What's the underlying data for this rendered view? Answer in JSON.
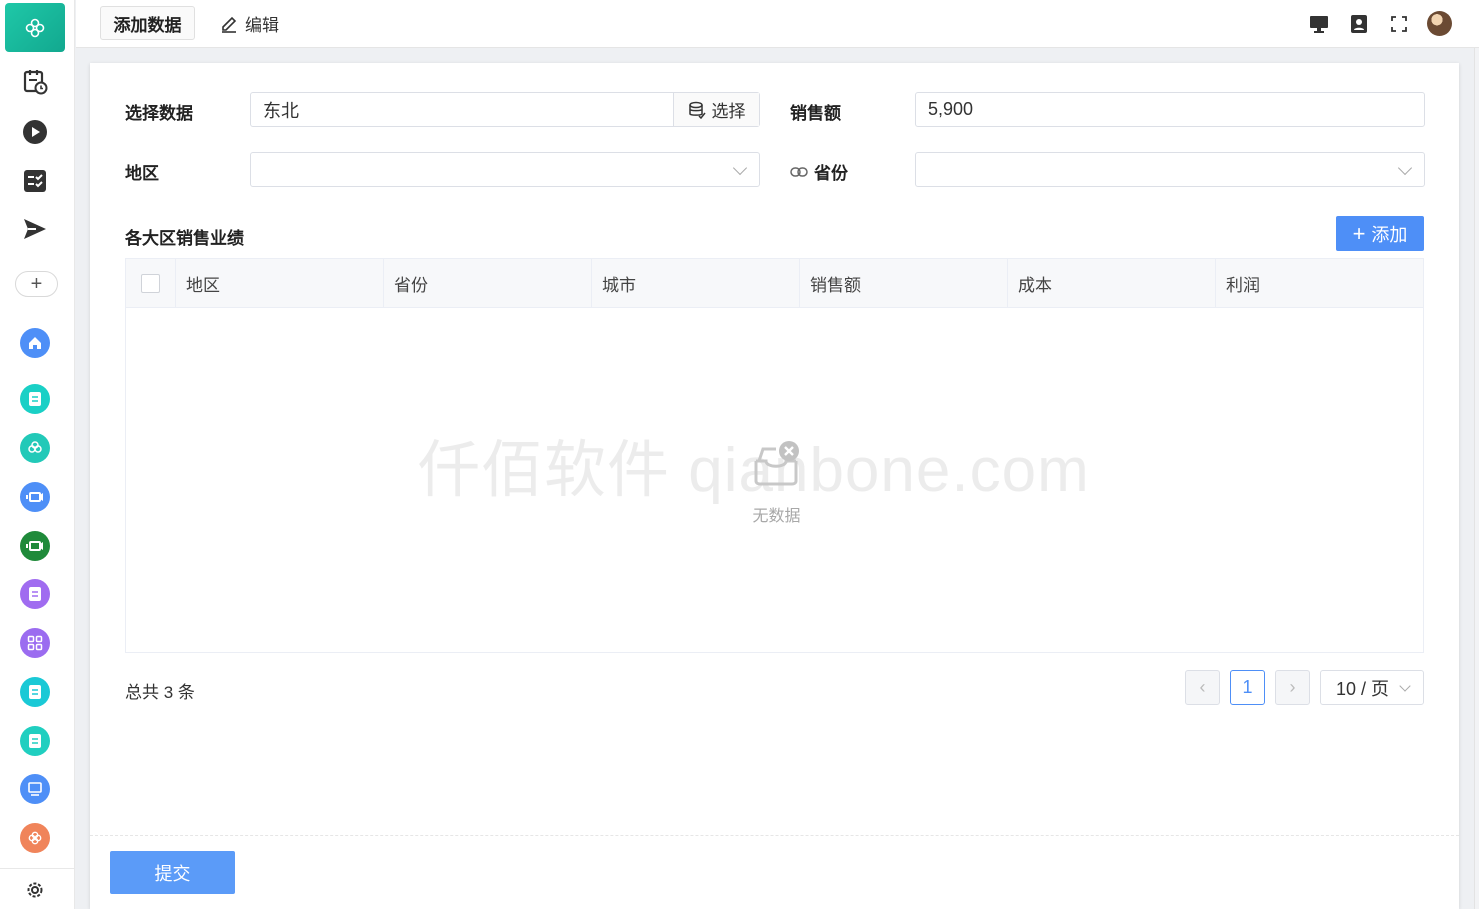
{
  "topbar": {
    "tab_active": "添加数据",
    "tab_edit": "编辑"
  },
  "sidebar": {
    "add_label": "+",
    "colors": {
      "home": "#4e8ff7",
      "doc_teal": "#1ad0c6",
      "flower_teal": "#22c9b8",
      "cam_blue": "#4e8ff7",
      "cam_green": "#1f8a3a",
      "doc_purple": "#a06cf0",
      "grid_purple": "#9b6cf0",
      "doc_teal2": "#1ac9d6",
      "doc_teal3": "#20cfc0",
      "screen_blue": "#4e8ff7",
      "flower_orange": "#f0845a"
    }
  },
  "form": {
    "select_data_label": "选择数据",
    "select_data_value": "东北",
    "select_button_label": "选择",
    "sales_label": "销售额",
    "sales_value": "5,900",
    "region_label": "地区",
    "region_value": "",
    "province_label": "省份",
    "province_value": ""
  },
  "table": {
    "title": "各大区销售业绩",
    "add_button": "添加",
    "columns": [
      "地区",
      "省份",
      "城市",
      "销售额",
      "成本",
      "利润"
    ],
    "rows": [],
    "empty_text": "无数据",
    "watermark": "仟佰软件 qianbone.com"
  },
  "pagination": {
    "total_text": "总共 3 条",
    "current_page": "1",
    "page_size": "10 / 页"
  },
  "footer": {
    "submit_label": "提交"
  },
  "accent_color": "#4e8ff7"
}
